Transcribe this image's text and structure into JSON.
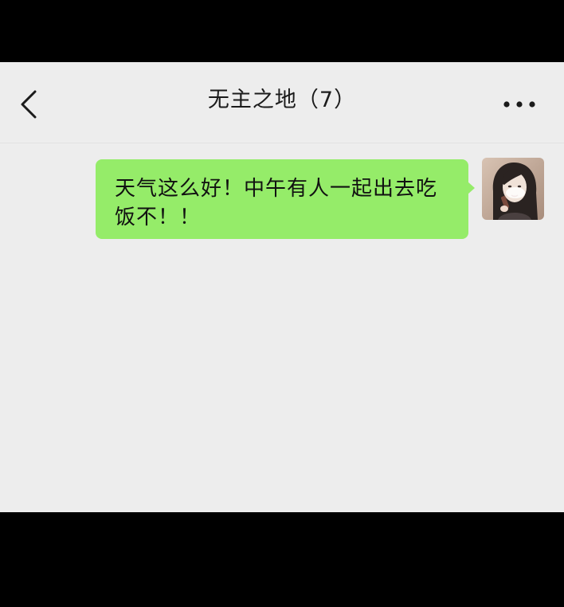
{
  "header": {
    "title": "无主之地（7）",
    "back_icon": "chevron-left-icon",
    "more_icon": "ellipsis-icon"
  },
  "messages": [
    {
      "sender": "self",
      "text": "天气这么好！中午有人一起出去吃饭不！！",
      "avatar": "avatar-woman-icon"
    }
  ],
  "colors": {
    "background": "#ededed",
    "bubble": "#95ec69",
    "frame": "#000000",
    "text": "#111111"
  }
}
